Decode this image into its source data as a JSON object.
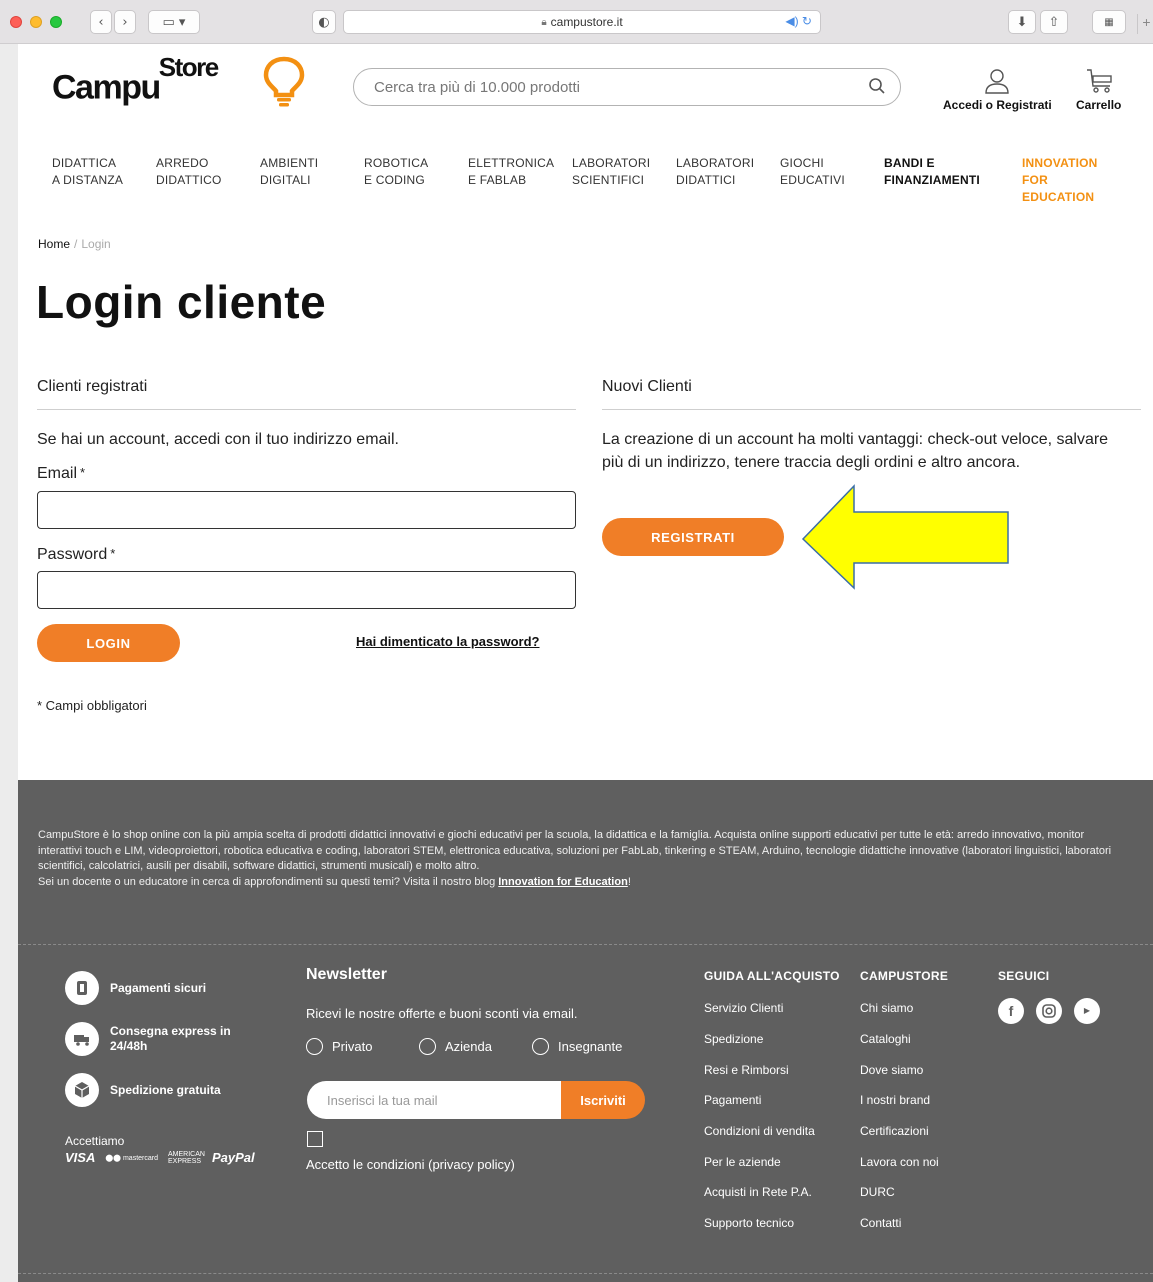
{
  "browser": {
    "url": "campustore.it"
  },
  "header": {
    "logo_text_main": "Campu",
    "logo_text_sup": "Store",
    "search_placeholder": "Cerca tra più di 10.000 prodotti",
    "account_label": "Accedi o Registrati",
    "cart_label": "Carrello"
  },
  "nav": [
    {
      "line1": "DIDATTICA",
      "line2": "A DISTANZA",
      "line3": ""
    },
    {
      "line1": "ARREDO",
      "line2": "DIDATTICO",
      "line3": ""
    },
    {
      "line1": "AMBIENTI",
      "line2": "DIGITALI",
      "line3": ""
    },
    {
      "line1": "ROBOTICA",
      "line2": "E CODING",
      "line3": ""
    },
    {
      "line1": "ELETTRONICA",
      "line2": "E FABLAB",
      "line3": ""
    },
    {
      "line1": "LABORATORI",
      "line2": "SCIENTIFICI",
      "line3": ""
    },
    {
      "line1": "LABORATORI",
      "line2": "DIDATTICI",
      "line3": ""
    },
    {
      "line1": "GIOCHI",
      "line2": "EDUCATIVI",
      "line3": ""
    },
    {
      "line1": "BANDI E",
      "line2": "FINANZIAMENTI",
      "line3": ""
    },
    {
      "line1": "INNOVATION",
      "line2": "FOR",
      "line3": "EDUCATION"
    }
  ],
  "colors": {
    "accent_orange": "#f07e27",
    "nav_highlight": "#f39012",
    "footer_bg": "#5f5f5f",
    "arrow_yellow": "#ffff00"
  },
  "breadcrumb": {
    "home": "Home",
    "separator": "/",
    "current": "Login"
  },
  "page_title": "Login cliente",
  "registered": {
    "title": "Clienti registrati",
    "intro": "Se hai un account, accedi con il tuo indirizzo email.",
    "email_label": "Email",
    "email_value": "",
    "password_label": "Password",
    "password_value": "",
    "required_mark": "*",
    "login_button": "LOGIN",
    "forgot_link": "Hai dimenticato la password?",
    "required_note": "* Campi obbligatori"
  },
  "new_customers": {
    "title": "Nuovi Clienti",
    "text": "La creazione di un account ha molti vantaggi: check-out veloce, salvare più di un indirizzo, tenere traccia degli ordini e altro ancora.",
    "register_button": "REGISTRATI"
  },
  "footer": {
    "intro_p1": "CampuStore è lo shop online con la più ampia scelta di prodotti didattici innovativi e giochi educativi per la scuola, la didattica e la famiglia. Acquista online supporti educativi per tutte le età: arredo innovativo, monitor interattivi touch e LIM, videoproiettori, robotica educativa e coding, laboratori STEM, elettronica educativa, soluzioni per FabLab, tinkering e STEAM, Arduino, tecnologie didattiche innovative (laboratori linguistici, laboratori scientifici, calcolatrici, ausili per disabili, software didattici, strumenti musicali) e molto altro.",
    "intro_p2_pre": "Sei un docente o un educatore in cerca di approfondimenti su questi temi? Visita il nostro blog ",
    "intro_p2_link": "Innovation for Education",
    "intro_p2_post": "!",
    "features": [
      {
        "label": "Pagamenti sicuri",
        "icon": "secure-payment-icon"
      },
      {
        "label": "Consegna express in 24/48h",
        "icon": "delivery-truck-icon"
      },
      {
        "label": "Spedizione gratuita",
        "icon": "package-icon"
      }
    ],
    "accept_label": "Accettiamo",
    "payments": [
      "VISA",
      "mastercard",
      "AMERICAN EXPRESS",
      "PayPal"
    ],
    "newsletter": {
      "title": "Newsletter",
      "desc": "Ricevi le nostre offerte e buoni sconti via email.",
      "options": [
        "Privato",
        "Azienda",
        "Insegnante"
      ],
      "email_placeholder": "Inserisci la tua mail",
      "subscribe_button": "Iscriviti",
      "consent_label": "Accetto le condizioni (privacy policy)"
    },
    "guide": {
      "title": "GUIDA ALL'ACQUISTO",
      "links": [
        "Servizio Clienti",
        "Spedizione",
        "Resi e Rimborsi",
        "Pagamenti",
        "Condizioni di vendita",
        "Per le aziende",
        "Acquisti in Rete P.A.",
        "Supporto tecnico"
      ]
    },
    "campustore": {
      "title": "CAMPUSTORE",
      "links": [
        "Chi siamo",
        "Cataloghi",
        "Dove siamo",
        "I nostri brand",
        "Certificazioni",
        "Lavora con noi",
        "DURC",
        "Contatti"
      ]
    },
    "social": {
      "title": "SEGUICI",
      "icons": [
        "facebook-icon",
        "instagram-icon",
        "youtube-icon"
      ]
    }
  }
}
